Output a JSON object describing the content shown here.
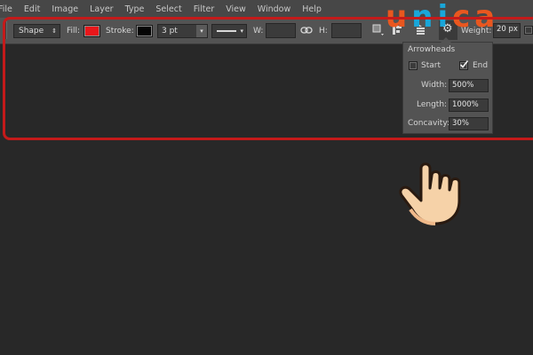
{
  "menubar": {
    "items": [
      "File",
      "Edit",
      "Image",
      "Layer",
      "Type",
      "Select",
      "Filter",
      "View",
      "Window",
      "Help"
    ]
  },
  "options": {
    "mode": "Shape",
    "fill_label": "Fill:",
    "stroke_label": "Stroke:",
    "stroke_width": "3 pt",
    "w_label": "W:",
    "h_label": "H:",
    "weight_label": "Weight:",
    "weight_value": "20 px",
    "fill_color": "#e8171b",
    "stroke_color": "#050505"
  },
  "arrowheads": {
    "title": "Arrowheads",
    "start_label": "Start",
    "start_checked": false,
    "end_label": "End",
    "end_checked": true,
    "width_label": "Width:",
    "width_value": "500%",
    "length_label": "Length:",
    "length_value": "1000%",
    "concavity_label": "Concavity:",
    "concavity_value": "30%"
  },
  "watermark": {
    "u": "u",
    "n": "n",
    "i": "i",
    "c": "c",
    "a": "a"
  },
  "colors": {
    "highlight": "#c41a1a",
    "watermark_orange": "#e9571f",
    "watermark_blue": "#19a6d9"
  }
}
